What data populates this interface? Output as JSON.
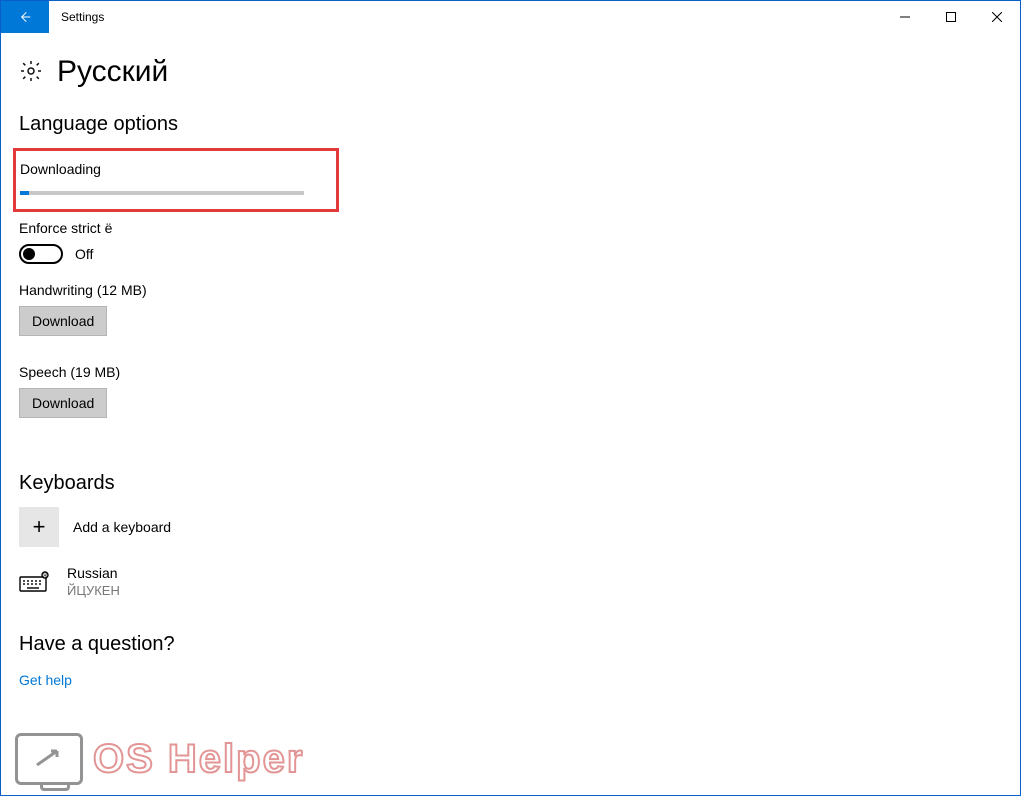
{
  "window": {
    "title": "Settings"
  },
  "page": {
    "title": "Русский",
    "section_language_options": "Language options",
    "downloading_label": "Downloading",
    "download_progress_percent": 3,
    "enforce_label": "Enforce strict ё",
    "toggle_state": "Off",
    "handwriting": {
      "label": "Handwriting (12 MB)",
      "button": "Download"
    },
    "speech": {
      "label": "Speech (19 MB)",
      "button": "Download"
    },
    "section_keyboards": "Keyboards",
    "add_keyboard": "Add a keyboard",
    "keyboard": {
      "name": "Russian",
      "layout": "ЙЦУКЕН"
    },
    "question_heading": "Have a question?",
    "help_link": "Get help"
  },
  "watermark": "OS Helper"
}
